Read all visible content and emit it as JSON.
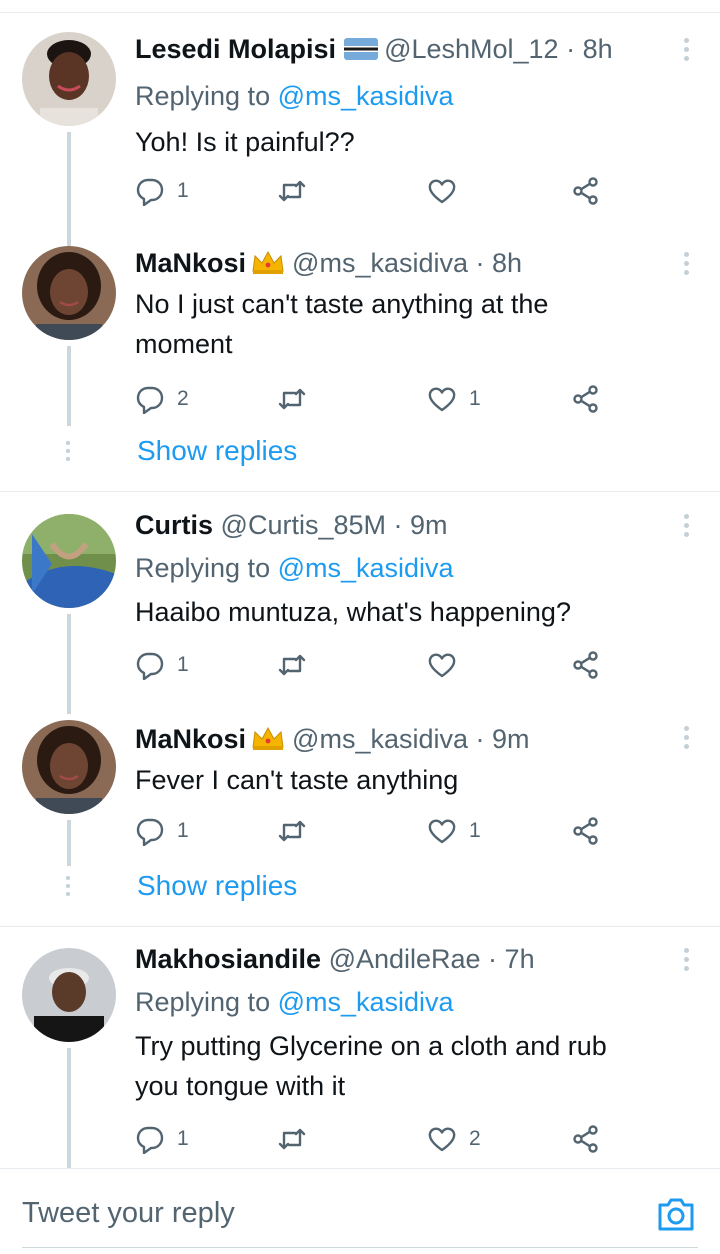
{
  "tweets": [
    {
      "name": "Lesedi Molapisi",
      "flag": "botswana-flag",
      "handle": "@LeshMol_12 · 8h",
      "replying_prefix": "Replying to",
      "replying_to": "@ms_kasidiva",
      "text": "Yoh! Is it painful??",
      "replies": "1",
      "retweets": "",
      "likes": "",
      "avatar_color": "#b9b0a6"
    },
    {
      "name": "MaNkosi",
      "badge": "crown-emoji",
      "handle": "@ms_kasidiva · 8h",
      "text_line1": "No I just can't taste anything at the",
      "text_line2": "moment",
      "replies": "2",
      "retweets": "",
      "likes": "1",
      "avatar_color": "#6b4a35"
    },
    {
      "name": "Curtis",
      "handle": "@Curtis_85M · 9m",
      "replying_prefix": "Replying to",
      "replying_to": "@ms_kasidiva",
      "text": "Haaibo muntuza, what's happening?",
      "replies": "1",
      "retweets": "",
      "likes": "",
      "avatar_color": "#3d6fb6"
    },
    {
      "name": "MaNkosi",
      "badge": "crown-emoji",
      "handle": "@ms_kasidiva · 9m",
      "text": "Fever I can't taste anything",
      "replies": "1",
      "retweets": "",
      "likes": "1",
      "avatar_color": "#6b4a35"
    },
    {
      "name": "Makhosiandile",
      "handle": "@AndileRae · 7h",
      "replying_prefix": "Replying to",
      "replying_to": "@ms_kasidiva",
      "text_line1": "Try putting Glycerine on a cloth and rub",
      "text_line2": "you tongue with it",
      "replies": "1",
      "retweets": "",
      "likes": "2",
      "avatar_color": "#8a8f97"
    }
  ],
  "show_replies_label": "Show replies",
  "composer": {
    "placeholder": "Tweet your reply",
    "icon": "camera-icon"
  },
  "colors": {
    "accent": "#1d9bf0",
    "secondary_text": "#536471",
    "divider": "#e6ecf0"
  }
}
